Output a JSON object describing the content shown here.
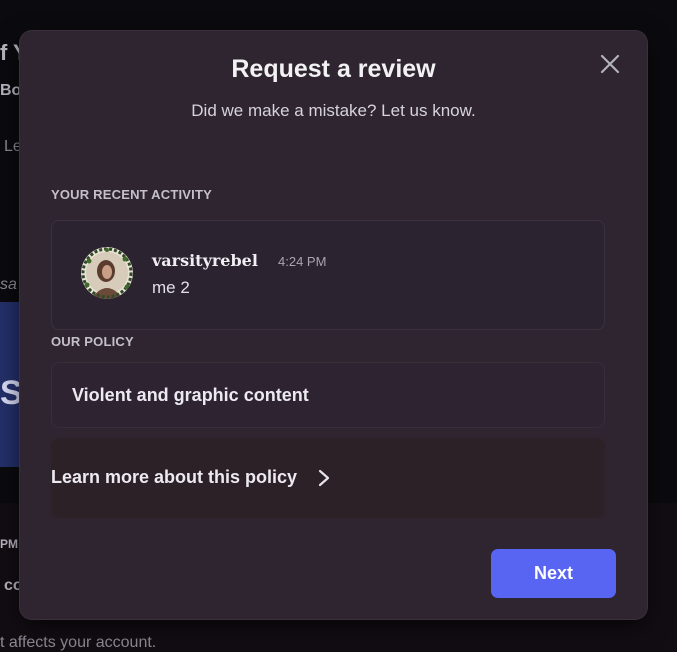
{
  "background": {
    "fragments": [
      "f Y",
      "Boo",
      "Le",
      "sa",
      "S",
      "PM",
      "co",
      "t affects your account."
    ]
  },
  "modal": {
    "title": "Request a review",
    "subtitle": "Did we make a mistake? Let us know.",
    "close_icon": "close-icon",
    "activity_section_label": "YOUR RECENT ACTIVITY",
    "activity": {
      "username": "varsityrebel",
      "timestamp": "4:24 PM",
      "message": "me 2",
      "avatar_icon": "avatar-image"
    },
    "policy_section_label": "OUR POLICY",
    "policy_name": "Violent and graphic content",
    "learn_more_label": "Learn more about this policy",
    "learn_more_icon": "chevron-right-icon",
    "next_label": "Next"
  },
  "colors": {
    "modal_bg": "#2f2530",
    "accent": "#5865f2",
    "text_primary": "#f2f2f4",
    "text_muted": "#c4c0c9"
  }
}
